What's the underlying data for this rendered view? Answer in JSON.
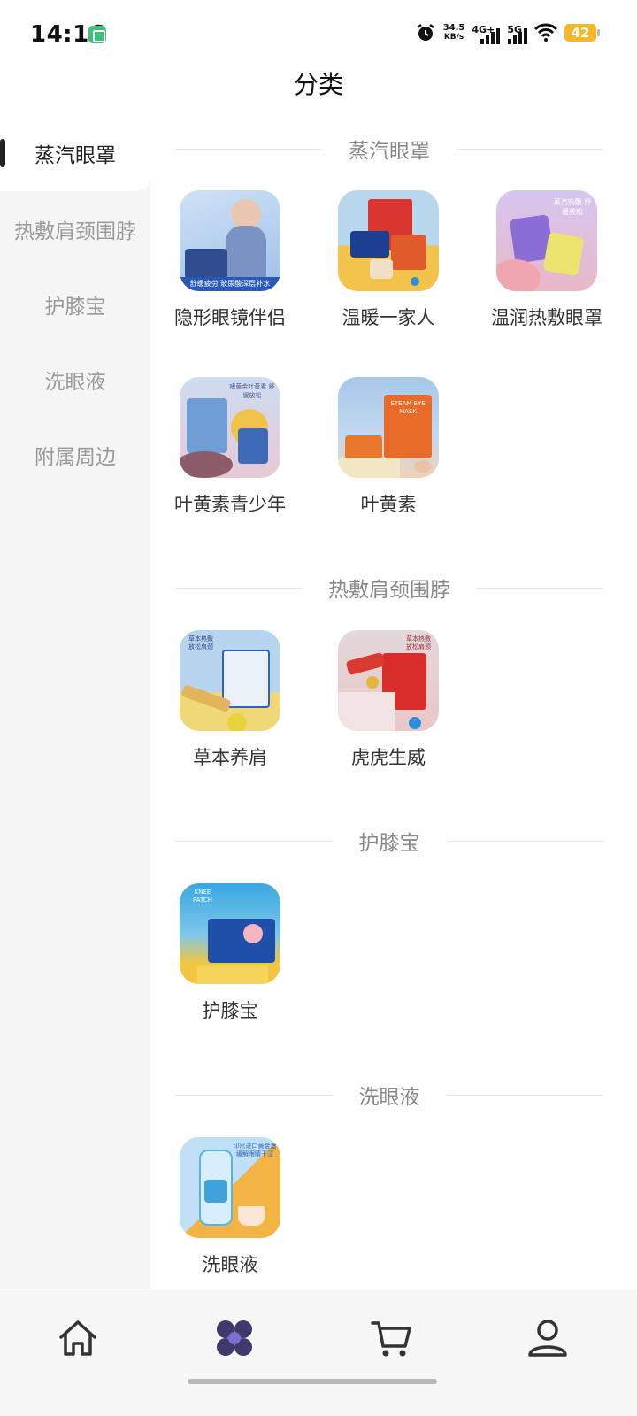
{
  "status": {
    "time": "14:16",
    "speed_value": "34.5",
    "speed_unit": "KB/s",
    "net1": "4G+",
    "net2": "5G",
    "battery": "42"
  },
  "header": {
    "title": "分类"
  },
  "sidebar": {
    "items": [
      {
        "label": "蒸汽眼罩",
        "active": true
      },
      {
        "label": "热敷肩颈围脖",
        "active": false
      },
      {
        "label": "护膝宝",
        "active": false
      },
      {
        "label": "洗眼液",
        "active": false
      },
      {
        "label": "附属周边",
        "active": false
      }
    ]
  },
  "sections": [
    {
      "title": "蒸汽眼罩",
      "products": [
        {
          "name": "隐形眼镜伴侣",
          "thumb_text": "舒缓疲劳 玻尿酸深层补水"
        },
        {
          "name": "温暖一家人"
        },
        {
          "name": "温润热敷眼罩",
          "thumb_text": "蒸汽热敷 舒缓放松"
        },
        {
          "name": "叶黄素青少年",
          "thumb_text": "嗜黄金叶黄素 舒缓放松"
        },
        {
          "name": "叶黄素",
          "thumb_text": "STEAM EYE MASK"
        }
      ]
    },
    {
      "title": "热敷肩颈围脖",
      "products": [
        {
          "name": "草本养肩",
          "thumb_text": "草本热敷 放松肩颈"
        },
        {
          "name": "虎虎生威",
          "thumb_text": "草本热敷 放松肩颈"
        }
      ]
    },
    {
      "title": "护膝宝",
      "products": [
        {
          "name": "护膝宝",
          "thumb_text": "KNEE PATCH"
        }
      ]
    },
    {
      "title": "洗眼液",
      "products": [
        {
          "name": "洗眼液",
          "thumb_text": "印尼进口黄金盏 缓解眼睛干涩"
        }
      ]
    }
  ],
  "bottom_nav": [
    {
      "icon": "home-icon"
    },
    {
      "icon": "category-icon"
    },
    {
      "icon": "cart-icon"
    },
    {
      "icon": "profile-icon"
    }
  ],
  "colors": {
    "sidebar_bg": "#f5f5f5",
    "active_indicator": "#222222",
    "battery": "#f6b82a",
    "category_icon": "#3f3a6b"
  }
}
